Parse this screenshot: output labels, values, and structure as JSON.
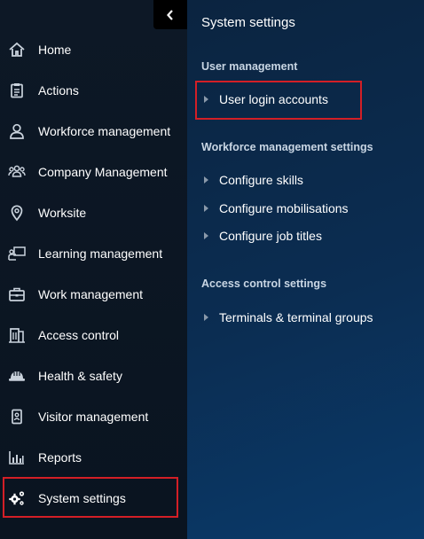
{
  "sidebar": {
    "collapse_icon": "chevron-left-icon",
    "items": [
      {
        "label": "Home",
        "icon": "home-icon"
      },
      {
        "label": "Actions",
        "icon": "clipboard-icon"
      },
      {
        "label": "Workforce management",
        "icon": "user-icon"
      },
      {
        "label": "Company Management",
        "icon": "users-group-icon"
      },
      {
        "label": "Worksite",
        "icon": "map-pin-icon"
      },
      {
        "label": "Learning management",
        "icon": "presentation-icon"
      },
      {
        "label": "Work management",
        "icon": "briefcase-icon"
      },
      {
        "label": "Access control",
        "icon": "building-door-icon"
      },
      {
        "label": "Health & safety",
        "icon": "hard-hat-icon"
      },
      {
        "label": "Visitor management",
        "icon": "id-badge-icon"
      },
      {
        "label": "Reports",
        "icon": "bar-chart-icon"
      },
      {
        "label": "System settings",
        "icon": "gears-icon",
        "selected": true
      }
    ]
  },
  "panel": {
    "title": "System settings",
    "sections": [
      {
        "heading": "User management",
        "links": [
          "User login accounts"
        ]
      },
      {
        "heading": "Workforce management settings",
        "links": [
          "Configure skills",
          "Configure mobilisations",
          "Configure job titles"
        ]
      },
      {
        "heading": "Access control settings",
        "links": [
          "Terminals & terminal groups"
        ]
      }
    ]
  },
  "colors": {
    "highlight": "#d31f26",
    "sidebar_bg": "#0d1826",
    "panel_bg": "#0b2d52"
  }
}
